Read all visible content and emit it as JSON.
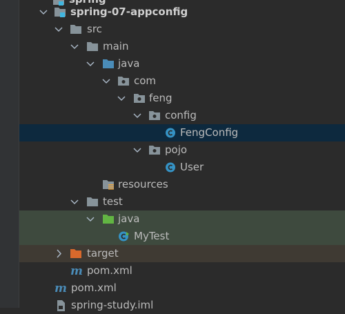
{
  "project_tree": {
    "top_partial_label": "spring",
    "items": [
      {
        "label": "spring-07-appconfig",
        "icon": "module-folder-icon"
      },
      {
        "label": "src",
        "icon": "folder-icon"
      },
      {
        "label": "main",
        "icon": "folder-icon"
      },
      {
        "label": "java",
        "icon": "source-root-folder-icon"
      },
      {
        "label": "com",
        "icon": "package-icon"
      },
      {
        "label": "feng",
        "icon": "package-icon"
      },
      {
        "label": "config",
        "icon": "package-icon"
      },
      {
        "label": "FengConfig",
        "icon": "class-icon"
      },
      {
        "label": "pojo",
        "icon": "package-icon"
      },
      {
        "label": "User",
        "icon": "class-icon"
      },
      {
        "label": "resources",
        "icon": "resources-folder-icon"
      },
      {
        "label": "test",
        "icon": "folder-icon"
      },
      {
        "label": "java",
        "icon": "test-root-folder-icon"
      },
      {
        "label": "MyTest",
        "icon": "test-class-icon"
      },
      {
        "label": "target",
        "icon": "excluded-folder-icon"
      },
      {
        "label": "pom.xml",
        "icon": "maven-icon"
      },
      {
        "label": "pom.xml",
        "icon": "maven-icon"
      },
      {
        "label": "spring-study.iml",
        "icon": "iml-file-icon"
      }
    ]
  },
  "colors": {
    "background": "#2B2B2B",
    "selection": "#0D293E",
    "test_row": "#3E4A3E",
    "excluded_row": "#3F3A33",
    "text": "#BBBBBB",
    "class_icon": "#3592C4",
    "source_root": "#4A8CB8",
    "test_root": "#62B543",
    "excluded": "#D9692C"
  }
}
